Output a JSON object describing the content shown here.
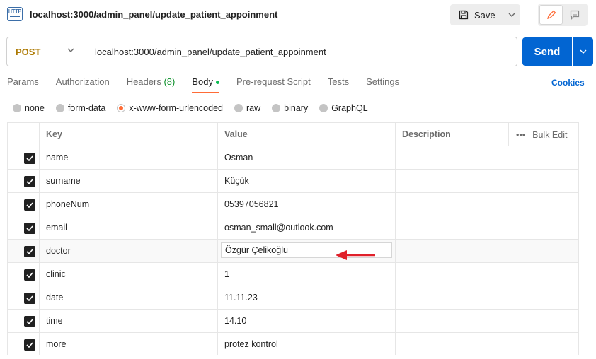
{
  "tab_title": "localhost:3000/admin_panel/update_patient_appoinment",
  "toolbar": {
    "save_label": "Save"
  },
  "request": {
    "method": "POST",
    "url": "localhost:3000/admin_panel/update_patient_appoinment",
    "send_label": "Send"
  },
  "tabs": [
    {
      "label": "Params"
    },
    {
      "label": "Authorization"
    },
    {
      "label": "Headers",
      "count": "(8)"
    },
    {
      "label": "Body"
    },
    {
      "label": "Pre-request Script"
    },
    {
      "label": "Tests"
    },
    {
      "label": "Settings"
    }
  ],
  "cookies_label": "Cookies",
  "body_types": [
    "none",
    "form-data",
    "x-www-form-urlencoded",
    "raw",
    "binary",
    "GraphQL"
  ],
  "selected_body_type": "x-www-form-urlencoded",
  "table": {
    "headers": {
      "key": "Key",
      "value": "Value",
      "description": "Description",
      "bulk_edit": "Bulk Edit"
    },
    "rows": [
      {
        "key": "name",
        "value": "Osman",
        "checked": true
      },
      {
        "key": "surname",
        "value": "Küçük",
        "checked": true
      },
      {
        "key": "phoneNum",
        "value": "05397056821",
        "checked": true
      },
      {
        "key": "email",
        "value": "osman_small@outlook.com",
        "checked": true
      },
      {
        "key": "doctor",
        "value": "Özgür Çelikoğlu",
        "checked": true
      },
      {
        "key": "clinic",
        "value": "1",
        "checked": true
      },
      {
        "key": "date",
        "value": "11.11.23",
        "checked": true
      },
      {
        "key": "time",
        "value": "14.10",
        "checked": true
      },
      {
        "key": "more",
        "value": "protez kontrol",
        "checked": true
      }
    ]
  },
  "colors": {
    "accent": "#ff6c37",
    "send": "#0265d2",
    "method": "#ad7a03",
    "arrow": "#e0202a"
  }
}
